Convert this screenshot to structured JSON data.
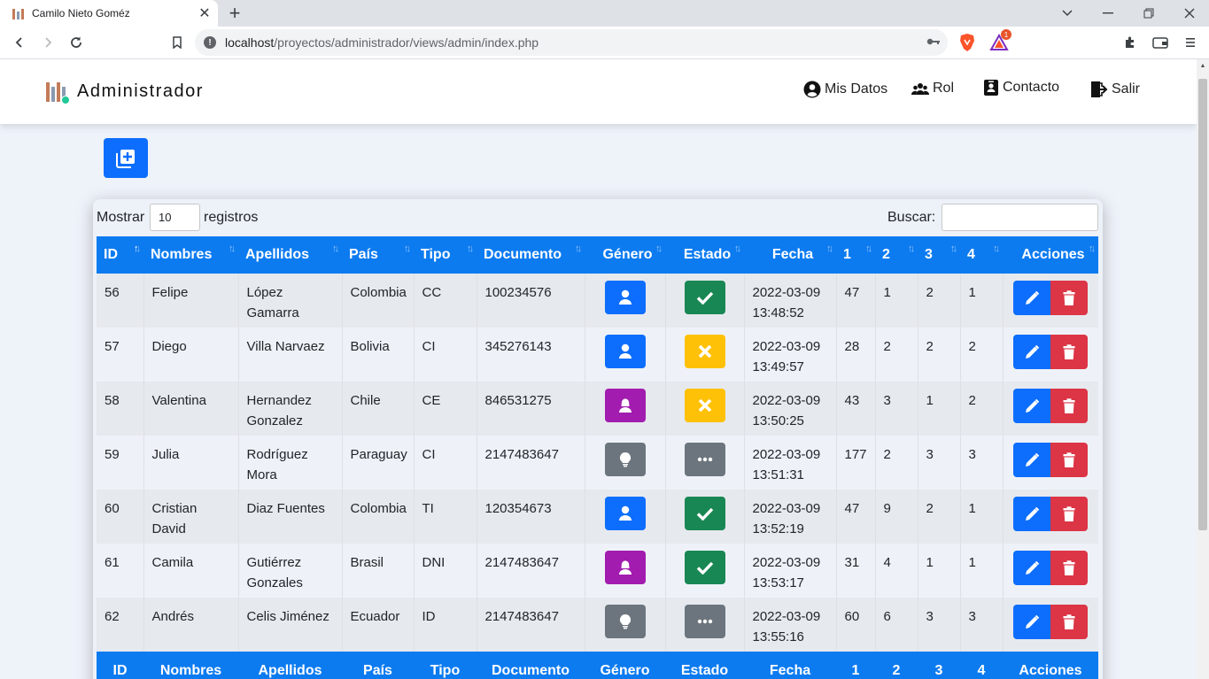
{
  "browser": {
    "tab_title": "Camilo Nieto Goméz",
    "url_prefix": "localhost",
    "url_path": "/proyectos/administrador/views/admin/index.php",
    "brave_badge": "1"
  },
  "app": {
    "brand": "Administrador",
    "menu": {
      "mis_datos": "Mis Datos",
      "rol": "Rol",
      "contacto": "Contacto",
      "salir": "Salir"
    }
  },
  "table_controls": {
    "show_label": "Mostrar",
    "page_length": "10",
    "records_label": "registros",
    "search_label": "Buscar:"
  },
  "columns": [
    "ID",
    "Nombres",
    "Apellidos",
    "País",
    "Tipo",
    "Documento",
    "Género",
    "Estado",
    "Fecha",
    "1",
    "2",
    "3",
    "4",
    "Acciones"
  ],
  "rows": [
    {
      "id": "56",
      "nombres": "Felipe",
      "apellidos": "López Gamarra",
      "pais": "Colombia",
      "tipo": "CC",
      "documento": "100234576",
      "genero": "male",
      "estado": "active",
      "fecha": "2022-03-09 13:48:52",
      "c1": "47",
      "c2": "1",
      "c3": "2",
      "c4": "1"
    },
    {
      "id": "57",
      "nombres": "Diego",
      "apellidos": "Villa Narvaez",
      "pais": "Bolivia",
      "tipo": "CI",
      "documento": "345276143",
      "genero": "male",
      "estado": "inactive",
      "fecha": "2022-03-09 13:49:57",
      "c1": "28",
      "c2": "2",
      "c3": "2",
      "c4": "2"
    },
    {
      "id": "58",
      "nombres": "Valentina",
      "apellidos": "Hernandez Gonzalez",
      "pais": "Chile",
      "tipo": "CE",
      "documento": "846531275",
      "genero": "female",
      "estado": "inactive",
      "fecha": "2022-03-09 13:50:25",
      "c1": "43",
      "c2": "3",
      "c3": "1",
      "c4": "2"
    },
    {
      "id": "59",
      "nombres": "Julia",
      "apellidos": "Rodríguez Mora",
      "pais": "Paraguay",
      "tipo": "CI",
      "documento": "2147483647",
      "genero": "other",
      "estado": "pending",
      "fecha": "2022-03-09 13:51:31",
      "c1": "177",
      "c2": "2",
      "c3": "3",
      "c4": "3"
    },
    {
      "id": "60",
      "nombres": "Cristian David",
      "apellidos": "Diaz Fuentes",
      "pais": "Colombia",
      "tipo": "TI",
      "documento": "120354673",
      "genero": "male",
      "estado": "active",
      "fecha": "2022-03-09 13:52:19",
      "c1": "47",
      "c2": "9",
      "c3": "2",
      "c4": "1"
    },
    {
      "id": "61",
      "nombres": "Camila",
      "apellidos": "Gutiérrez Gonzales",
      "pais": "Brasil",
      "tipo": "DNI",
      "documento": "2147483647",
      "genero": "female",
      "estado": "active",
      "fecha": "2022-03-09 13:53:17",
      "c1": "31",
      "c2": "4",
      "c3": "1",
      "c4": "1"
    },
    {
      "id": "62",
      "nombres": "Andrés",
      "apellidos": "Celis Jiménez",
      "pais": "Ecuador",
      "tipo": "ID",
      "documento": "2147483647",
      "genero": "other",
      "estado": "pending",
      "fecha": "2022-03-09 13:55:16",
      "c1": "60",
      "c2": "6",
      "c3": "3",
      "c4": "3"
    }
  ],
  "colors": {
    "primary": "#0d6efd",
    "header_blue": "#0d7bf0",
    "danger": "#dc3545",
    "success": "#198754",
    "warning": "#ffc107",
    "female": "#a21caf",
    "secondary": "#6c757d",
    "page_bg": "#eef2f9"
  },
  "icon_map": {
    "genero": {
      "male": "user-icon",
      "female": "user-female-icon",
      "other": "lightbulb-icon"
    },
    "estado": {
      "active": "check-icon",
      "inactive": "x-icon",
      "pending": "ellipsis-icon"
    }
  }
}
